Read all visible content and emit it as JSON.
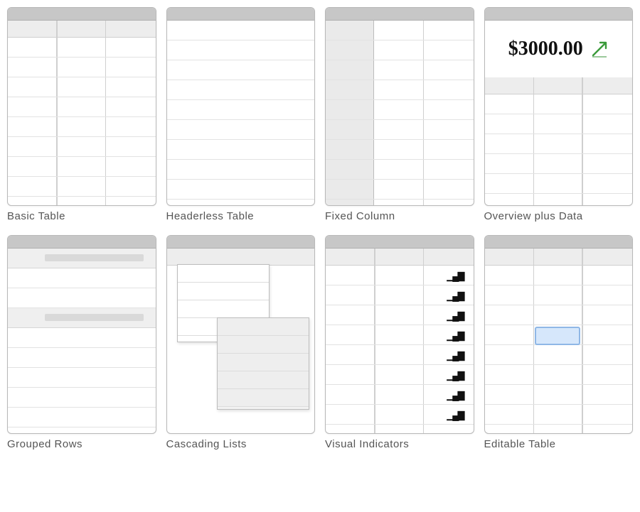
{
  "patterns": [
    {
      "id": "basic-table",
      "label": "Basic Table"
    },
    {
      "id": "headerless-table",
      "label": "Headerless Table"
    },
    {
      "id": "fixed-column",
      "label": "Fixed Column"
    },
    {
      "id": "overview-plus-data",
      "label": "Overview plus Data"
    },
    {
      "id": "grouped-rows",
      "label": "Grouped Rows"
    },
    {
      "id": "cascading-lists",
      "label": "Cascading Lists"
    },
    {
      "id": "visual-indicators",
      "label": "Visual Indicators"
    },
    {
      "id": "editable-table",
      "label": "Editable Table"
    }
  ],
  "overview": {
    "value": "$3000.00",
    "trend_icon": "up-arrow-icon"
  },
  "visual_indicator_icon": "bar-chart-icon"
}
